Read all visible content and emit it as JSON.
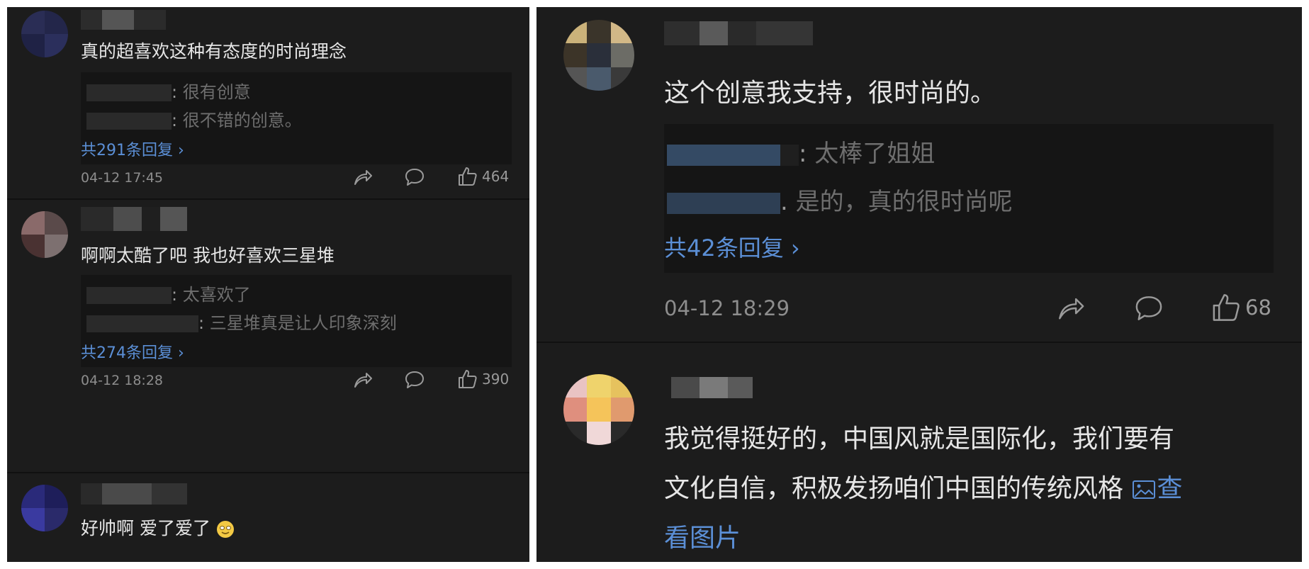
{
  "left": {
    "comments": [
      {
        "text": "真的超喜欢这种有态度的时尚理念",
        "replies": [
          {
            "text": "很有创意"
          },
          {
            "text": "很不错的创意。"
          }
        ],
        "reply_count": "共291条回复 ›",
        "time": "04-12 17:45",
        "likes": "464"
      },
      {
        "text": "啊啊太酷了吧 我也好喜欢三星堆",
        "replies": [
          {
            "text": "太喜欢了"
          },
          {
            "text": "三星堆真是让人印象深刻"
          }
        ],
        "reply_count": "共274条回复 ›",
        "time": "04-12 18:28",
        "likes": "390"
      },
      {
        "text": "好帅啊 爱了爱了",
        "emoji": "tearful-smile-emoji"
      }
    ]
  },
  "right": {
    "comments": [
      {
        "text": "这个创意我支持，很时尚的。",
        "replies": [
          {
            "text": "太棒了姐姐"
          },
          {
            "text": "是的，真的很时尚呢"
          }
        ],
        "reply_count": "共42条回复 ›",
        "time": "04-12 18:29",
        "likes": "68"
      },
      {
        "line1": "我觉得挺好的，中国风就是国际化，我们要有",
        "line2": "文化自信，积极发扬咱们中国的传统风格",
        "view_image_a": "查",
        "view_image_b": "看图片"
      }
    ]
  },
  "colors": {
    "background": "#1c1c1c",
    "primary_text": "#e6e6e6",
    "muted_text": "#8d8d8d",
    "link": "#5b8fd6"
  },
  "icons": [
    "share-icon",
    "comment-icon",
    "thumbs-up-icon",
    "image-icon"
  ]
}
